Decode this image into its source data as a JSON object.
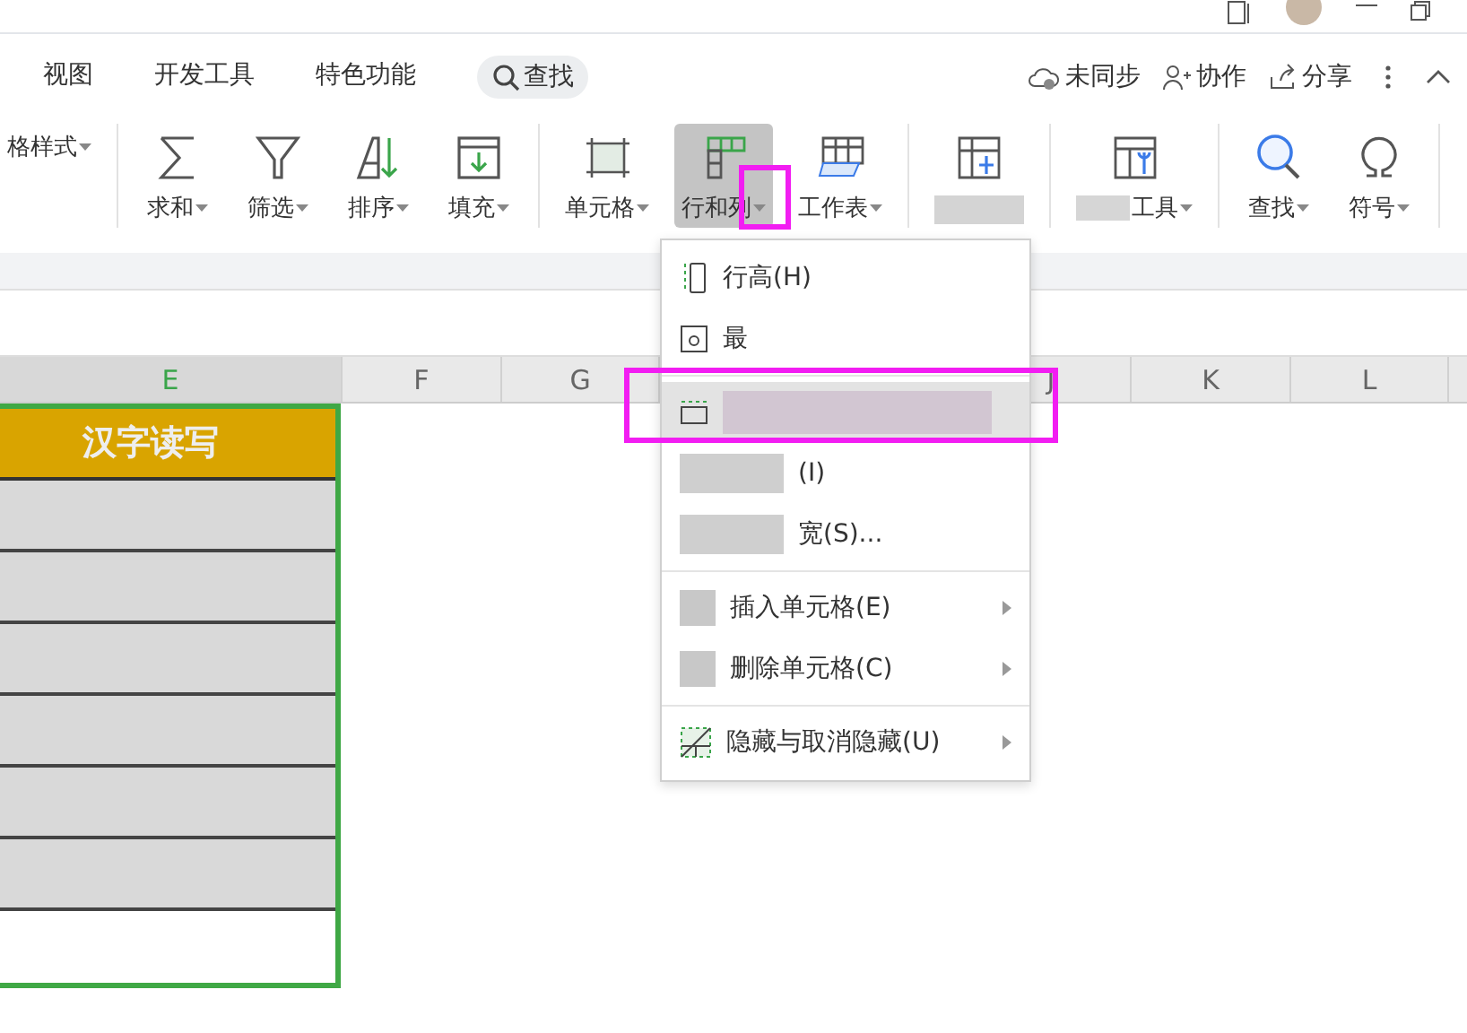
{
  "menu_tabs": [
    {
      "label": "视图",
      "selected": false
    },
    {
      "label": "开发工具",
      "selected": false
    },
    {
      "label": "特色功能",
      "selected": false
    }
  ],
  "search": {
    "label": "查找"
  },
  "actions": [
    {
      "kind": "cloud",
      "label": "未同步"
    },
    {
      "kind": "person",
      "label": "协作"
    },
    {
      "kind": "share",
      "label": "分享"
    }
  ],
  "ribbon": [
    [
      {
        "kind": "style",
        "label": "格样式",
        "active": false
      }
    ],
    [
      {
        "kind": "sum",
        "label": "求和",
        "active": false
      },
      {
        "kind": "filter",
        "label": "筛选",
        "active": false
      },
      {
        "kind": "sort",
        "label": "排序",
        "active": false
      },
      {
        "kind": "fill",
        "label": "填充",
        "active": false
      }
    ],
    [
      {
        "kind": "cell",
        "label": "单元格",
        "active": false
      },
      {
        "kind": "rowcol",
        "label": "行和列",
        "active": true
      },
      {
        "kind": "sheet",
        "label": "工作表",
        "active": false
      }
    ],
    [
      {
        "kind": "freeze",
        "active": false
      }
    ],
    [
      {
        "kind": "tools",
        "label": "工具",
        "active": false
      }
    ],
    [
      {
        "kind": "find",
        "label": "查找",
        "active": false
      },
      {
        "kind": "symbol",
        "label": "符号",
        "active": false
      }
    ]
  ],
  "columns": [
    {
      "label": "E",
      "selected": true
    },
    {
      "label": "F",
      "selected": false
    },
    {
      "label": "G",
      "selected": false
    },
    {
      "label": "J",
      "selected": false
    },
    {
      "label": "K",
      "selected": false
    },
    {
      "label": "L",
      "selected": false
    }
  ],
  "table": {
    "header": "汉字读写",
    "rows": [
      {
        "filled": true
      },
      {
        "filled": true
      },
      {
        "filled": true
      },
      {
        "filled": true
      },
      {
        "filled": true
      },
      {
        "filled": true
      },
      {
        "filled": false
      }
    ]
  },
  "dropdown": [
    {
      "kind": "rowheight",
      "label": "行高(H)",
      "submenu": false,
      "selected": false
    },
    {
      "kind": "autofit",
      "label": "最",
      "submenu": false,
      "selected": false
    },
    {
      "kind": "separator"
    },
    {
      "kind": "colwidth",
      "submenu": false,
      "selected": true
    },
    {
      "kind": "obscured",
      "label": "(I)",
      "submenu": false,
      "selected": false
    },
    {
      "kind": "obscured",
      "label": "宽(S)...",
      "submenu": false,
      "selected": false
    },
    {
      "kind": "separator"
    },
    {
      "kind": "obscured-icon",
      "label": "插入单元格(E)",
      "submenu": true,
      "selected": false
    },
    {
      "kind": "obscured-icon",
      "label": "删除单元格(C)",
      "submenu": true,
      "selected": false
    },
    {
      "kind": "separator"
    },
    {
      "kind": "hide",
      "label": "隐藏与取消隐藏(U)",
      "submenu": true,
      "selected": false
    }
  ]
}
